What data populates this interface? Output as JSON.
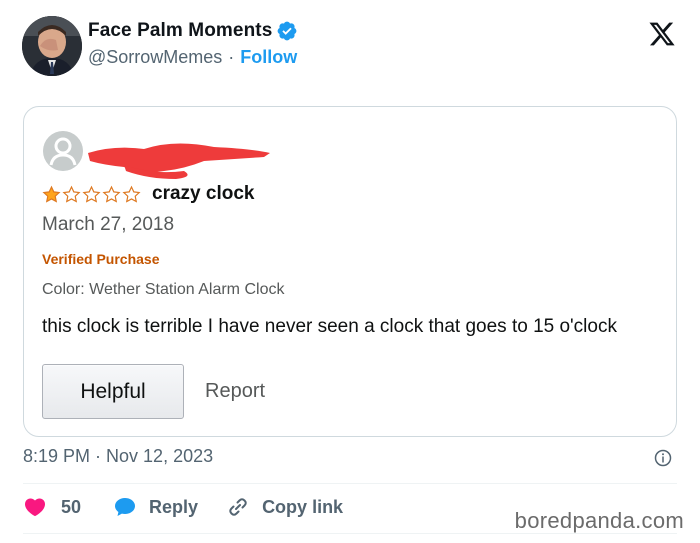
{
  "author": {
    "display_name": "Face Palm Moments",
    "handle": "@SorrowMemes",
    "separator": "·",
    "follow_label": "Follow",
    "verified_color": "#1d9bf0"
  },
  "review": {
    "rating": 1,
    "max_rating": 5,
    "title": "crazy clock",
    "date": "March 27, 2018",
    "verified_purchase": "Verified Purchase",
    "color_line": "Color: Wether Station Alarm Clock",
    "body": "this clock is terrible I have never seen a clock that goes to 15 o'clock",
    "helpful_label": "Helpful",
    "report_label": "Report"
  },
  "post": {
    "timestamp": "8:19 PM · Nov 12, 2023",
    "likes": "50",
    "reply_label": "Reply",
    "copy_link_label": "Copy link"
  },
  "watermark": "boredpanda.com",
  "colors": {
    "like": "#f91880",
    "reply": "#1d9bf0",
    "star": "#ffa41c",
    "redaction": "#ee3b3b"
  }
}
